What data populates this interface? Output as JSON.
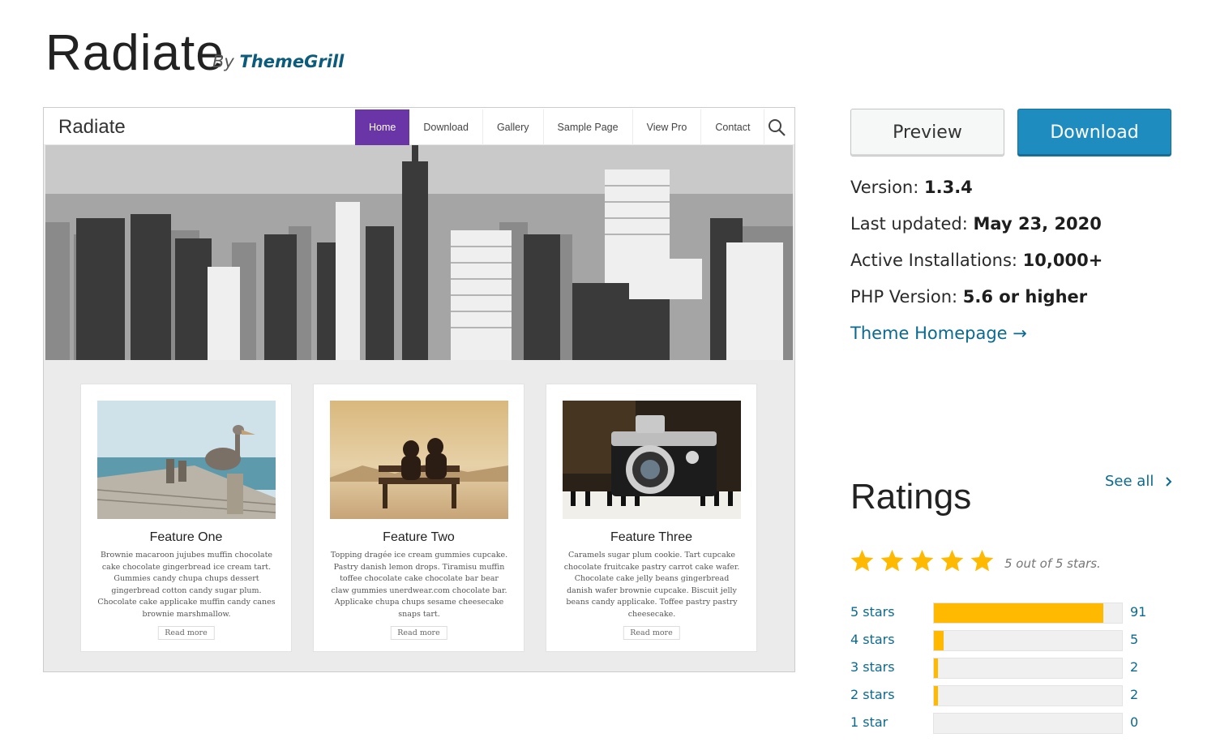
{
  "header": {
    "title": "Radiate",
    "by_prefix": "By",
    "author": "ThemeGrill"
  },
  "preview": {
    "site_logo": "Radiate",
    "menu": [
      {
        "label": "Home",
        "active": true
      },
      {
        "label": "Download",
        "active": false
      },
      {
        "label": "Gallery",
        "active": false
      },
      {
        "label": "Sample Page",
        "active": false
      },
      {
        "label": "View Pro",
        "active": false
      },
      {
        "label": "Contact",
        "active": false
      }
    ],
    "search_icon": "search-icon",
    "cards": [
      {
        "title": "Feature One",
        "text": "Brownie macaroon jujubes muffin chocolate cake chocolate gingerbread ice cream tart. Gummies candy chupa chups dessert gingerbread cotton candy sugar plum. Chocolate cake applicake muffin candy canes brownie marshmallow.",
        "more": "Read more"
      },
      {
        "title": "Feature Two",
        "text": "Topping dragée ice cream gummies cupcake. Pastry danish lemon drops. Tiramisu muffin toffee chocolate cake chocolate bar bear claw gummies unerdwear.com chocolate bar. Applicake chupa chups sesame cheesecake snaps tart.",
        "more": "Read more"
      },
      {
        "title": "Feature Three",
        "text": "Caramels sugar plum cookie. Tart cupcake chocolate fruitcake pastry carrot cake wafer. Chocolate cake jelly beans gingerbread danish wafer brownie cupcake. Biscuit jelly beans candy applicake. Toffee pastry pastry cheesecake.",
        "more": "Read more"
      }
    ]
  },
  "actions": {
    "preview_label": "Preview",
    "download_label": "Download"
  },
  "meta": {
    "version_label": "Version:",
    "version": "1.3.4",
    "updated_label": "Last updated:",
    "updated": "May 23, 2020",
    "installs_label": "Active Installations:",
    "installs": "10,000+",
    "php_label": "PHP Version:",
    "php": "5.6 or higher",
    "homepage_label": "Theme Homepage →"
  },
  "ratings": {
    "heading": "Ratings",
    "see_all": "See all",
    "stars_text": "5 out of 5 stars.",
    "average": 5,
    "rows": [
      {
        "label": "5 stars",
        "count": "91",
        "fraction": 0.9
      },
      {
        "label": "4 stars",
        "count": "5",
        "fraction": 0.05
      },
      {
        "label": "3 stars",
        "count": "2",
        "fraction": 0.02
      },
      {
        "label": "2 stars",
        "count": "2",
        "fraction": 0.02
      },
      {
        "label": "1 star",
        "count": "0",
        "fraction": 0
      }
    ]
  },
  "colors": {
    "accent": "#1e8cbe",
    "link": "#0a6a8f",
    "star": "#ffb900",
    "menu_active": "#6a35a6"
  }
}
